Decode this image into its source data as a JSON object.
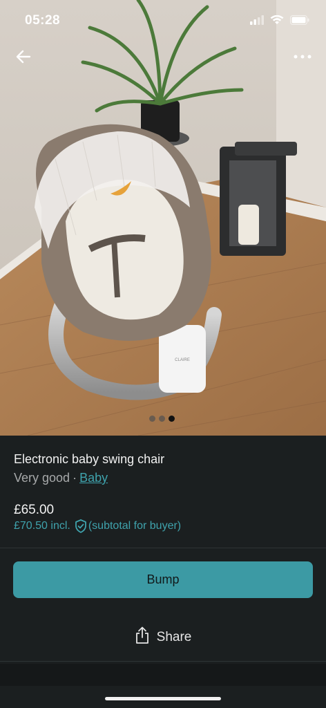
{
  "status_bar": {
    "time": "05:28"
  },
  "listing": {
    "title": "Electronic baby swing chair",
    "condition": "Very good",
    "separator": "·",
    "category": "Baby",
    "price": "£65.00",
    "price_incl": "£70.50 incl.",
    "buyer_note": "(subtotal for buyer)"
  },
  "photo": {
    "current_index": 3,
    "total": 3,
    "brand_label": "CLAIRE"
  },
  "actions": {
    "bump_label": "Bump",
    "share_label": "Share"
  },
  "colors": {
    "accent": "#3c9aa4",
    "link": "#3fa3ad",
    "background": "#1b1f20"
  },
  "icons": [
    "back-arrow-icon",
    "more-dots-icon",
    "signal-icon",
    "wifi-icon",
    "battery-icon",
    "shield-check-icon",
    "share-icon"
  ]
}
